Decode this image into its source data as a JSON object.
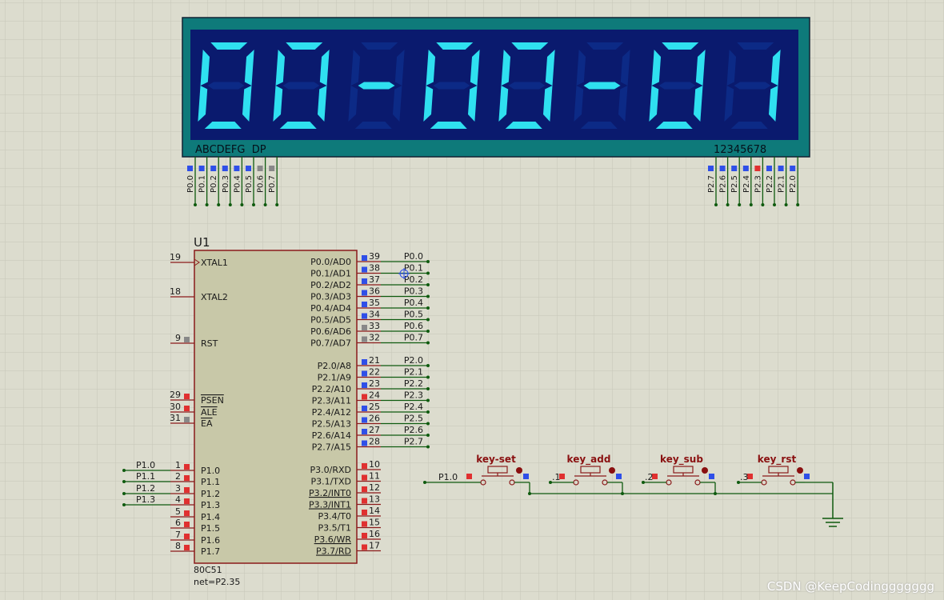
{
  "display": {
    "digits": [
      "0",
      "0",
      "-",
      "0",
      "0",
      "-",
      "0",
      "1"
    ],
    "segment_label": "ABCDEFG  DP",
    "digit_label": "12345678",
    "seg_pins": [
      "P0.0",
      "P0.1",
      "P0.2",
      "P0.3",
      "P0.4",
      "P0.5",
      "P0.6",
      "P0.7"
    ],
    "seg_pin_states": [
      "blue",
      "blue",
      "blue",
      "blue",
      "blue",
      "blue",
      "gray",
      "gray"
    ],
    "dig_pins": [
      "P2.7",
      "P2.6",
      "P2.5",
      "P2.4",
      "P2.3",
      "P2.2",
      "P2.1",
      "P2.0"
    ],
    "dig_pin_states": [
      "blue",
      "blue",
      "blue",
      "blue",
      "red",
      "blue",
      "blue",
      "blue"
    ],
    "colors": {
      "frame": "#0e7a7a",
      "panel": "#0a1a6e",
      "segment_on": "#2fe0f0",
      "segment_off": "#0c2a86"
    }
  },
  "mcu": {
    "designator": "U1",
    "part": "80C51",
    "net": "net=P2.35",
    "left_pins": [
      {
        "num": "19",
        "name": "XTAL1",
        "state": "none",
        "net": ""
      },
      {
        "num": "18",
        "name": "XTAL2",
        "state": "none",
        "net": ""
      },
      {
        "num": "9",
        "name": "RST",
        "state": "gray",
        "net": ""
      },
      {
        "num": "29",
        "name": "PSEN",
        "state": "red",
        "net": ""
      },
      {
        "num": "30",
        "name": "ALE",
        "state": "red",
        "net": ""
      },
      {
        "num": "31",
        "name": "EA",
        "state": "gray",
        "net": ""
      },
      {
        "num": "1",
        "name": "P1.0",
        "state": "red",
        "net": "P1.0"
      },
      {
        "num": "2",
        "name": "P1.1",
        "state": "red",
        "net": "P1.1"
      },
      {
        "num": "3",
        "name": "P1.2",
        "state": "red",
        "net": "P1.2"
      },
      {
        "num": "4",
        "name": "P1.3",
        "state": "red",
        "net": "P1.3"
      },
      {
        "num": "5",
        "name": "P1.4",
        "state": "red",
        "net": ""
      },
      {
        "num": "6",
        "name": "P1.5",
        "state": "red",
        "net": ""
      },
      {
        "num": "7",
        "name": "P1.6",
        "state": "red",
        "net": ""
      },
      {
        "num": "8",
        "name": "P1.7",
        "state": "red",
        "net": ""
      }
    ],
    "right_pins": [
      {
        "num": "39",
        "name": "P0.0/AD0",
        "state": "blue",
        "net": "P0.0"
      },
      {
        "num": "38",
        "name": "P0.1/AD1",
        "state": "blue",
        "net": "P0.1"
      },
      {
        "num": "37",
        "name": "P0.2/AD2",
        "state": "blue",
        "net": "P0.2"
      },
      {
        "num": "36",
        "name": "P0.3/AD3",
        "state": "blue",
        "net": "P0.3"
      },
      {
        "num": "35",
        "name": "P0.4/AD4",
        "state": "blue",
        "net": "P0.4"
      },
      {
        "num": "34",
        "name": "P0.5/AD5",
        "state": "blue",
        "net": "P0.5"
      },
      {
        "num": "33",
        "name": "P0.6/AD6",
        "state": "gray",
        "net": "P0.6"
      },
      {
        "num": "32",
        "name": "P0.7/AD7",
        "state": "gray",
        "net": "P0.7"
      },
      {
        "num": "21",
        "name": "P2.0/A8",
        "state": "blue",
        "net": "P2.0"
      },
      {
        "num": "22",
        "name": "P2.1/A9",
        "state": "blue",
        "net": "P2.1"
      },
      {
        "num": "23",
        "name": "P2.2/A10",
        "state": "blue",
        "net": "P2.2"
      },
      {
        "num": "24",
        "name": "P2.3/A11",
        "state": "red",
        "net": "P2.3"
      },
      {
        "num": "25",
        "name": "P2.4/A12",
        "state": "blue",
        "net": "P2.4"
      },
      {
        "num": "26",
        "name": "P2.5/A13",
        "state": "blue",
        "net": "P2.5"
      },
      {
        "num": "27",
        "name": "P2.6/A14",
        "state": "blue",
        "net": "P2.6"
      },
      {
        "num": "28",
        "name": "P2.7/A15",
        "state": "blue",
        "net": "P2.7"
      },
      {
        "num": "10",
        "name": "P3.0/RXD",
        "state": "red",
        "net": ""
      },
      {
        "num": "11",
        "name": "P3.1/TXD",
        "state": "red",
        "net": ""
      },
      {
        "num": "12",
        "name": "P3.2/INT0",
        "state": "red",
        "net": ""
      },
      {
        "num": "13",
        "name": "P3.3/INT1",
        "state": "red",
        "net": ""
      },
      {
        "num": "14",
        "name": "P3.4/T0",
        "state": "red",
        "net": ""
      },
      {
        "num": "15",
        "name": "P3.5/T1",
        "state": "red",
        "net": ""
      },
      {
        "num": "16",
        "name": "P3.6/WR",
        "state": "red",
        "net": ""
      },
      {
        "num": "17",
        "name": "P3.7/RD",
        "state": "red",
        "net": ""
      }
    ]
  },
  "buttons": [
    {
      "label": "key-set",
      "net": "P1.0",
      "state": "red"
    },
    {
      "label": "key_add",
      "net": "P1.1",
      "state": "red"
    },
    {
      "label": "key_sub",
      "net": "P1.2",
      "state": "red"
    },
    {
      "label": "key_rst",
      "net": "P1.3",
      "state": "red"
    }
  ],
  "watermark": "CSDN @KeepCodinggggggg",
  "colors": {
    "background": "#dcdcce",
    "grid": "#c6c6b8",
    "wire": "#0e5a0e",
    "chip_fill": "#c8c8a8",
    "chip_border": "#8a1a1a",
    "pin": "#8a1a1a",
    "label_dark": "#1a1a1a",
    "button_label": "#8a1010",
    "pin_red": "#e03030",
    "pin_blue": "#2f4fe8",
    "pin_gray": "#888888"
  }
}
